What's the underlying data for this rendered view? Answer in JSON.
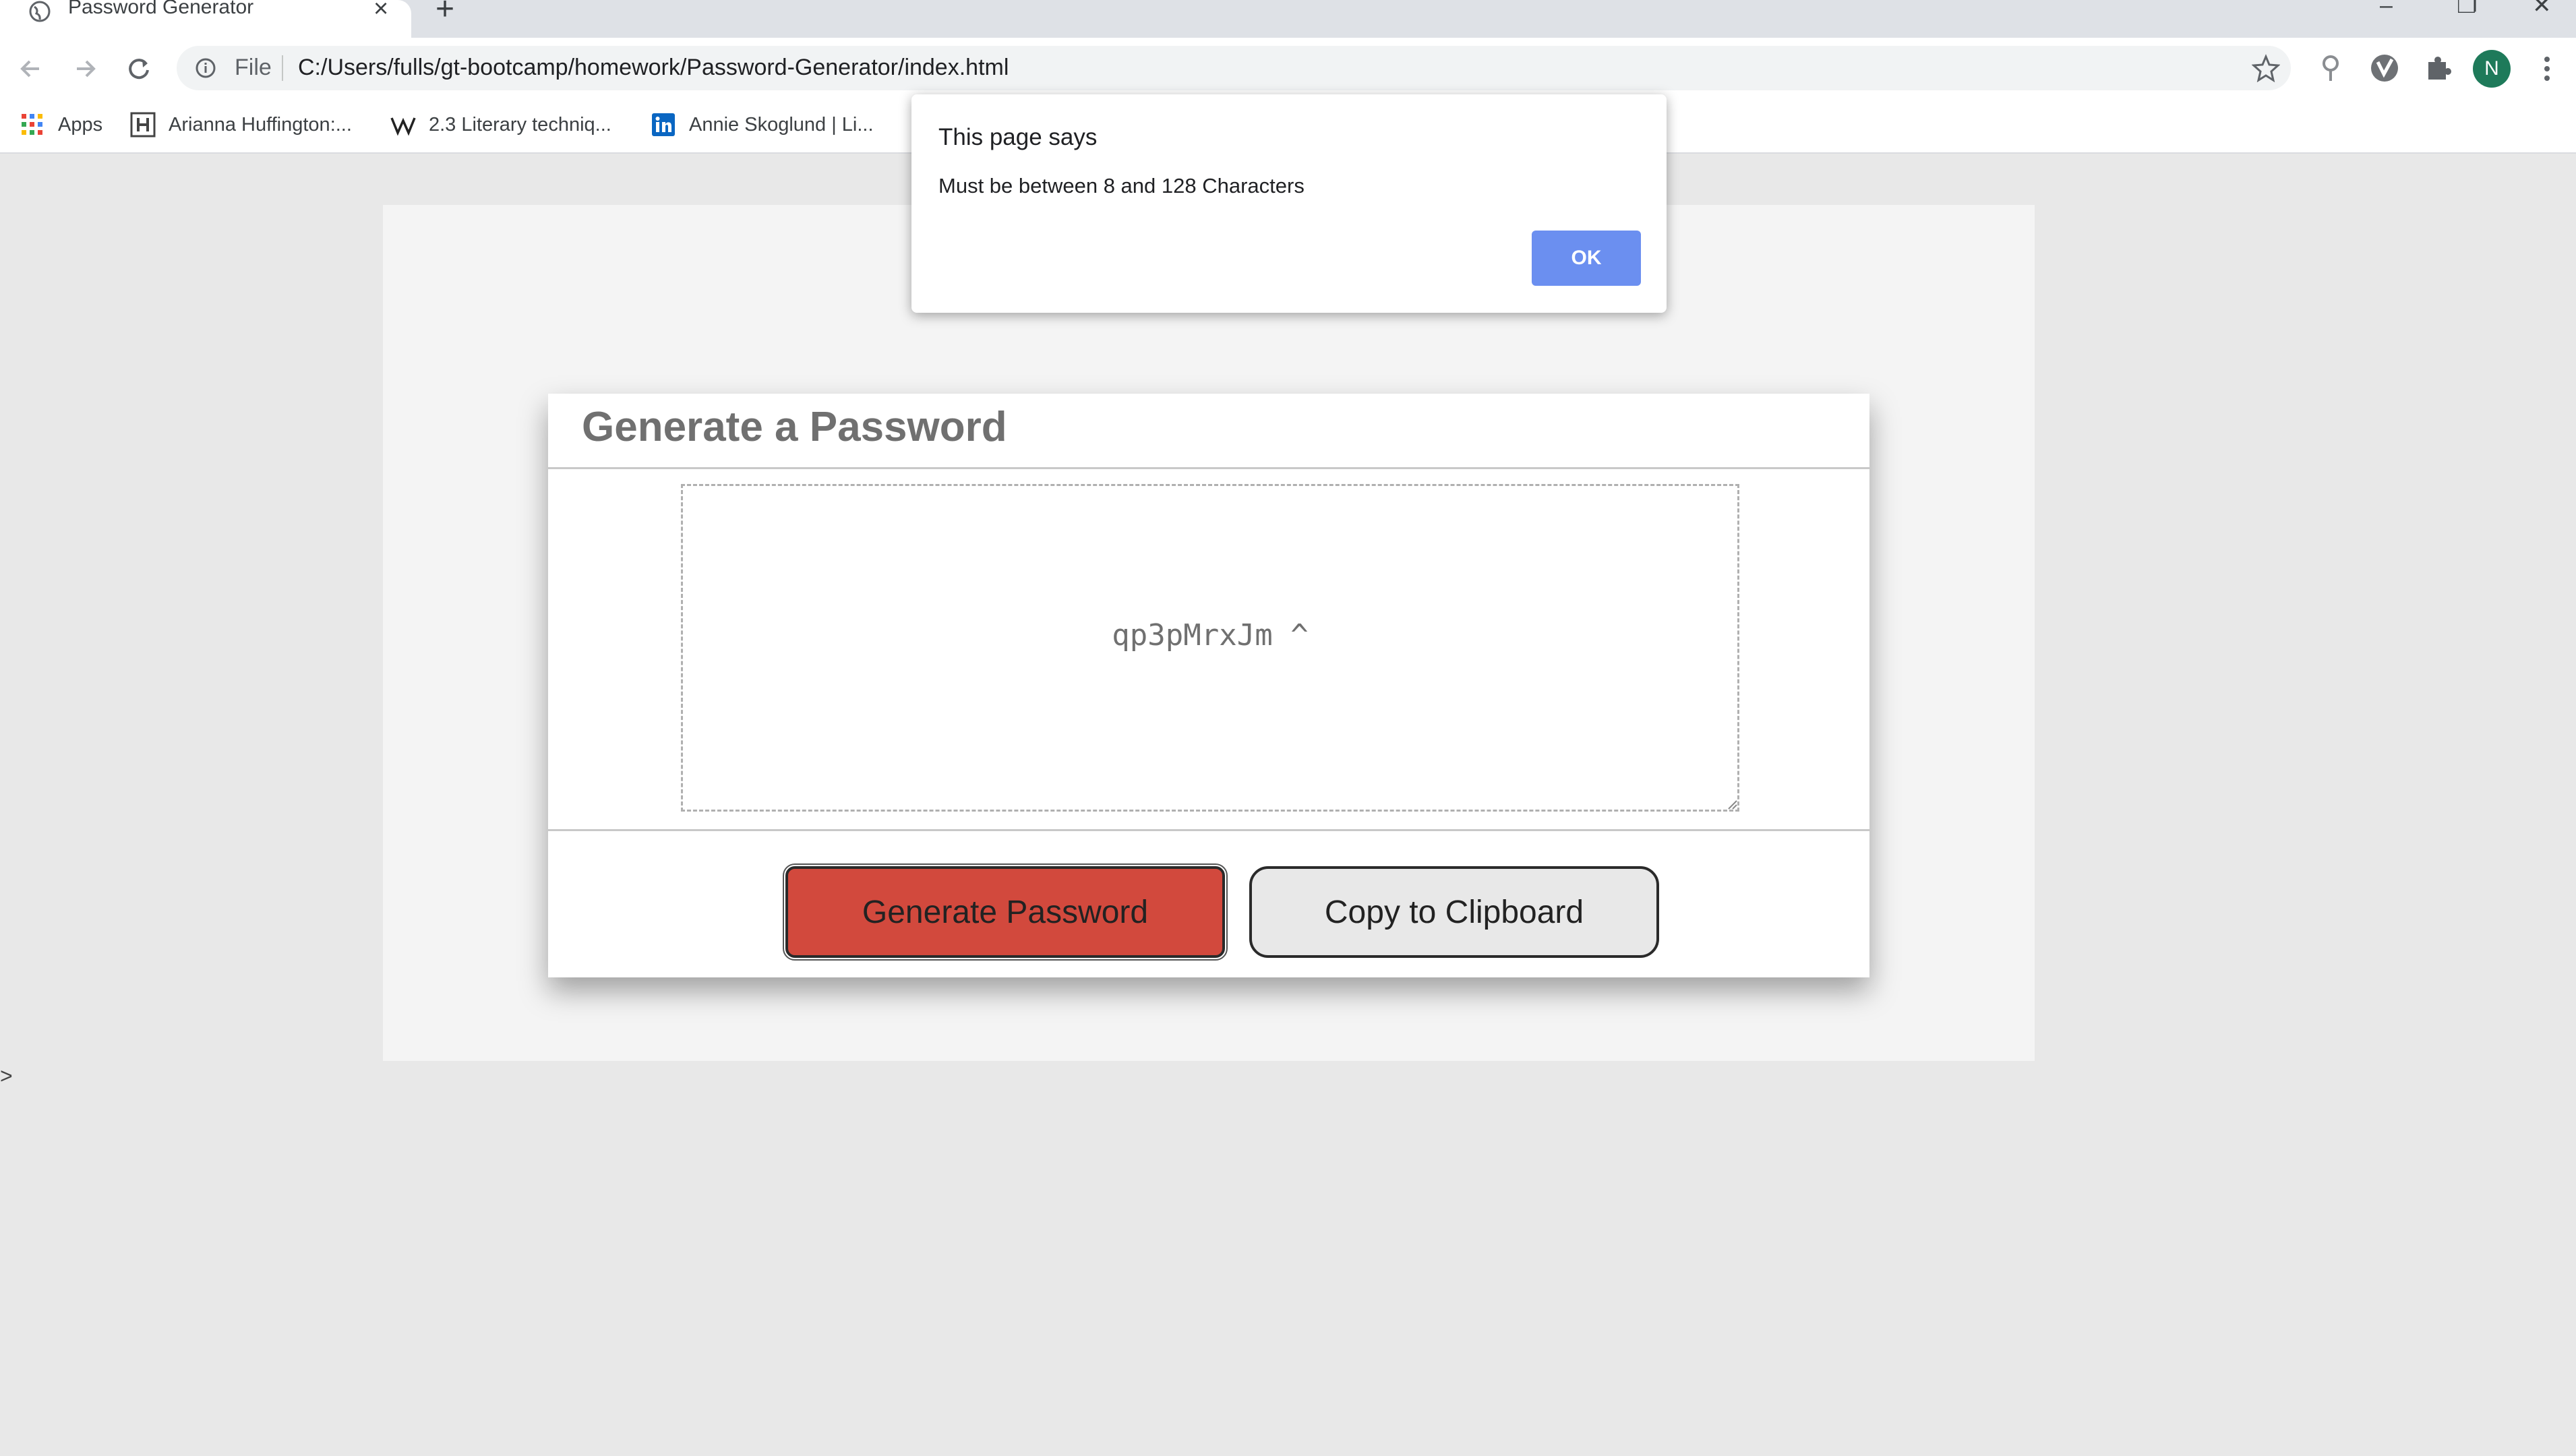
{
  "browser": {
    "tab_title": "Password Generator",
    "tab_close": "×",
    "new_tab": "+",
    "window_controls": {
      "minimize": "–",
      "maximize": "❐",
      "close": "✕"
    },
    "omnibox": {
      "scheme_label": "File",
      "url": "C:/Users/fulls/gt-bootcamp/homework/Password-Generator/index.html"
    },
    "profile_initial": "N",
    "bookmarks": [
      {
        "label": "Apps",
        "icon": "apps-grid-icon"
      },
      {
        "label": "Arianna Huffington:...",
        "icon": "huffpost-icon"
      },
      {
        "label": "2.3 Literary techniq...",
        "icon": "wikipedia-icon"
      },
      {
        "label": "Annie Skoglund | Li...",
        "icon": "linkedin-icon"
      }
    ]
  },
  "page": {
    "card_title": "Generate a Password",
    "password_value": "qp3pMrxJm ^",
    "generate_label": "Generate Password",
    "copy_label": "Copy to Clipboard",
    "side_caret": ">"
  },
  "alert": {
    "title": "This page says",
    "message": "Must be between 8 and 128 Characters",
    "ok_label": "OK"
  },
  "colors": {
    "generate_button": "#d2493d",
    "alert_ok": "#6b8ff0",
    "avatar": "#1e7a5a"
  }
}
